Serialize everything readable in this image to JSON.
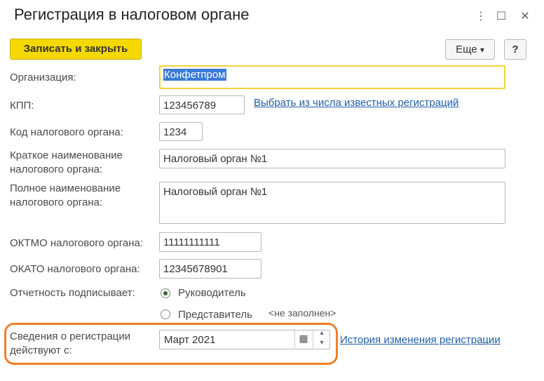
{
  "window": {
    "title": "Регистрация в налоговом органе",
    "menu_icon": "⋮",
    "maximize_icon": "☐",
    "close_icon": "✕"
  },
  "toolbar": {
    "save_close_label": "Записать и закрыть",
    "more_label": "Еще",
    "more_arrow": "▾",
    "help_label": "?"
  },
  "form": {
    "organization": {
      "label": "Организация:",
      "value": "Конфетпром"
    },
    "kpp": {
      "label": "КПП:",
      "value": "123456789",
      "link": "Выбрать из числа известных регистраций"
    },
    "tax_code": {
      "label": "Код налогового органа:",
      "value": "1234"
    },
    "short_name": {
      "label_line1": "Краткое наименование",
      "label_line2": "налогового органа:",
      "value": "Налоговый орган №1"
    },
    "full_name": {
      "label_line1": "Полное наименование",
      "label_line2": "налогового органа:",
      "value": "Налоговый орган №1"
    },
    "oktmo": {
      "label": "ОКТМО налогового органа:",
      "value": "11111111111"
    },
    "okato": {
      "label": "ОКАТО налогового органа:",
      "value": "12345678901"
    },
    "signer": {
      "label": "Отчетность подписывает:",
      "options": [
        "Руководитель",
        "Представитель"
      ],
      "selected": "Руководитель",
      "empty_hint": "<не заполнен>"
    },
    "valid_from": {
      "label_line1": "Сведения о регистрации",
      "label_line2": "действуют с:",
      "value": "Март 2021",
      "calendar_icon": "▦",
      "up_icon": "▴",
      "down_icon": "▾",
      "history_link": "История изменения регистрации"
    }
  },
  "colors": {
    "primary_button": "#f5d800",
    "focus_border": "#f2d23a",
    "link": "#1f5fa6",
    "highlight": "#f07f27"
  }
}
